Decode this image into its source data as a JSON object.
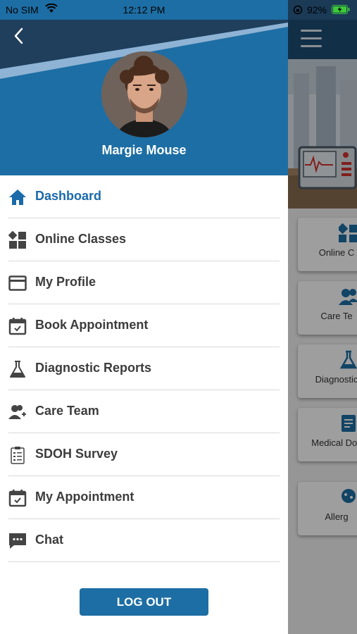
{
  "status_bar": {
    "carrier": "No SIM",
    "time": "12:12 PM",
    "battery": "92%"
  },
  "drawer": {
    "user_name": "Margie Mouse",
    "menu": [
      {
        "label": "Dashboard",
        "icon": "home-icon",
        "active": true
      },
      {
        "label": "Online Classes",
        "icon": "classes-icon",
        "active": false
      },
      {
        "label": "My Profile",
        "icon": "profile-card-icon",
        "active": false
      },
      {
        "label": "Book Appointment",
        "icon": "calendar-check-icon",
        "active": false
      },
      {
        "label": "Diagnostic Reports",
        "icon": "flask-icon",
        "active": false
      },
      {
        "label": "Care Team",
        "icon": "team-icon",
        "active": false
      },
      {
        "label": "SDOH Survey",
        "icon": "clipboard-icon",
        "active": false
      },
      {
        "label": "My Appointment",
        "icon": "calendar-check-icon",
        "active": false
      },
      {
        "label": "Chat",
        "icon": "chat-icon",
        "active": false
      }
    ],
    "logout_label": "LOG OUT"
  },
  "background_app": {
    "cards": [
      {
        "label": "Online C",
        "icon": "classes-icon"
      },
      {
        "label": "Care Te",
        "icon": "team-icon"
      },
      {
        "label": "Diagnostic",
        "icon": "flask-icon"
      },
      {
        "label": "Medical Doc",
        "icon": "document-icon"
      },
      {
        "label": "Allerg",
        "icon": "allergy-icon"
      }
    ]
  },
  "colors": {
    "primary": "#1d6ea4",
    "active_text": "#1a6aa9",
    "menu_text": "#3c3c3c",
    "battery_green": "#3dc93a"
  }
}
